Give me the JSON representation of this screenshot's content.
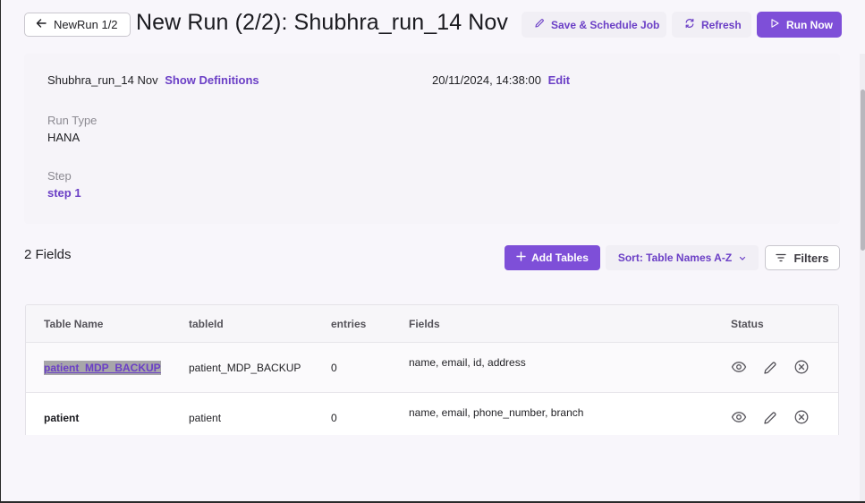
{
  "header": {
    "back_label": "NewRun 1/2",
    "title": "New Run (2/2): Shubhra_run_14 Nov",
    "save_label": "Save & Schedule Job",
    "refresh_label": "Refresh",
    "run_label": "Run Now"
  },
  "info": {
    "run_name": "Shubhra_run_14 Nov",
    "show_definitions": "Show Definitions",
    "datetime": "20/11/2024, 14:38:00",
    "edit_label": "Edit",
    "run_type_label": "Run Type",
    "run_type_value": "HANA",
    "step_label": "Step",
    "step_value": "step 1"
  },
  "toolbar": {
    "fields_count": "2 Fields",
    "add_tables_label": "Add Tables",
    "sort_label": "Sort: Table Names A-Z",
    "filters_label": "Filters"
  },
  "table": {
    "columns": [
      "Table Name",
      "tableId",
      "entries",
      "Fields",
      "Status"
    ],
    "rows": [
      {
        "table_name": "patient_MDP_BACKUP",
        "table_id": "patient_MDP_BACKUP",
        "entries": "0",
        "fields": "name, email, id, address"
      },
      {
        "table_name": "patient",
        "table_id": "patient",
        "entries": "0",
        "fields": "name, email, phone_number, branch"
      }
    ]
  },
  "colors": {
    "accent": "#7e4fd8",
    "accent_text": "#6b3fc6",
    "background": "#f8f6fb"
  },
  "icons": [
    "arrow-left-icon",
    "pencil-icon",
    "refresh-icon",
    "play-icon",
    "plus-icon",
    "chevron-down-icon",
    "filter-icon",
    "eye-icon",
    "edit-icon",
    "close-circle-icon"
  ]
}
